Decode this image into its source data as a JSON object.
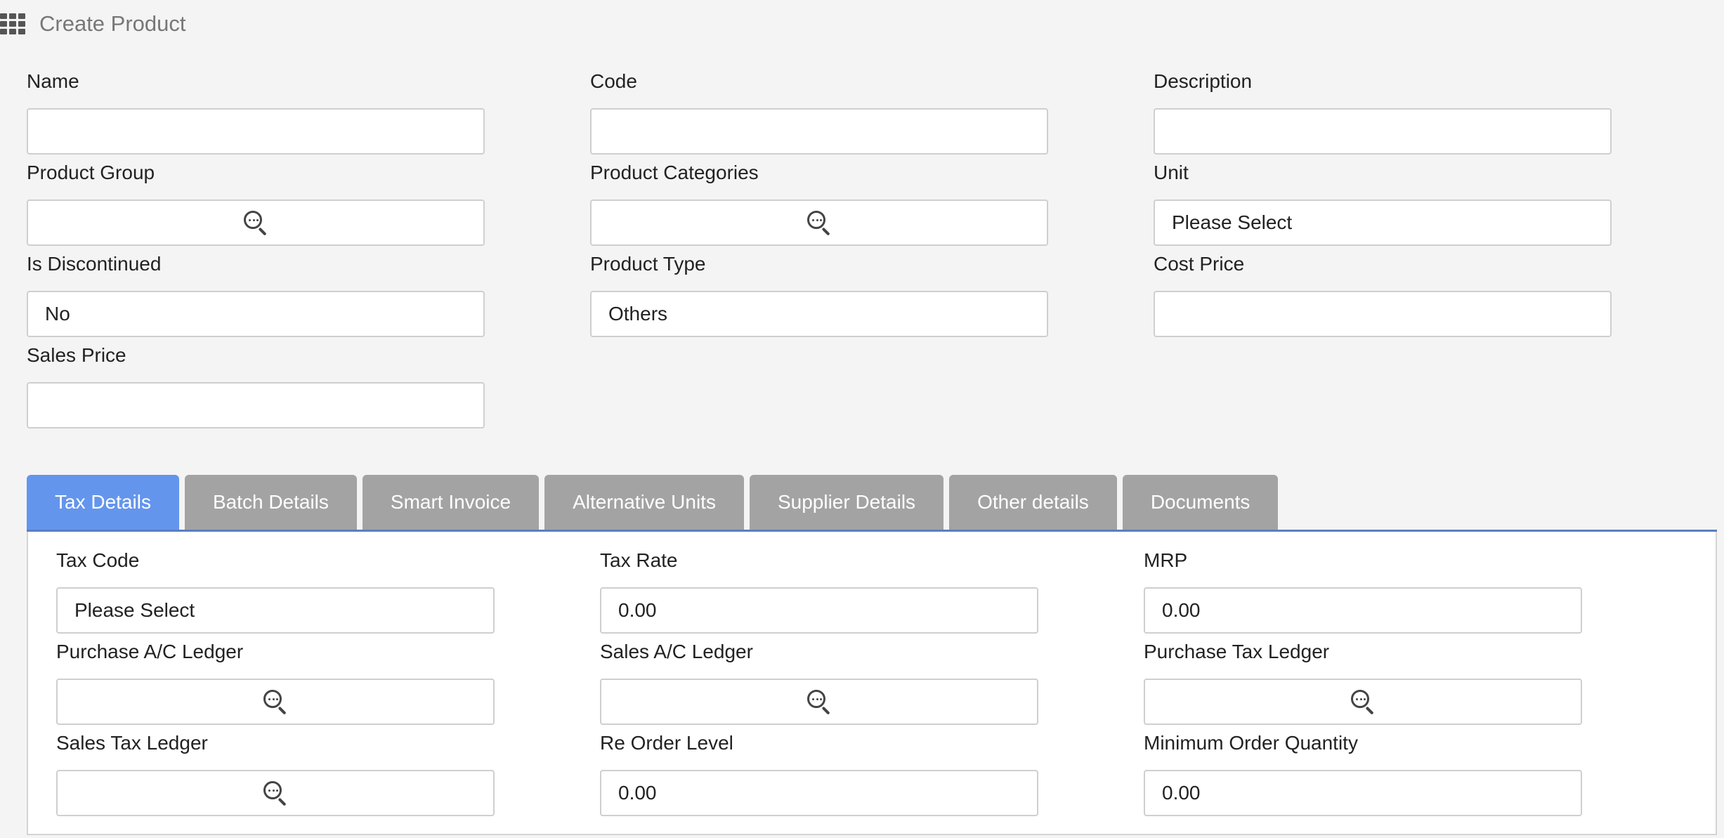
{
  "header": {
    "title": "Create Product",
    "icon": "apps-grid-icon"
  },
  "form": {
    "name": {
      "label": "Name",
      "value": ""
    },
    "code": {
      "label": "Code",
      "value": ""
    },
    "description": {
      "label": "Description",
      "value": ""
    },
    "product_group": {
      "label": "Product Group",
      "value": ""
    },
    "product_categories": {
      "label": "Product Categories",
      "value": ""
    },
    "unit": {
      "label": "Unit",
      "value": "Please Select"
    },
    "is_discontinued": {
      "label": "Is Discontinued",
      "value": "No"
    },
    "product_type": {
      "label": "Product Type",
      "value": "Others"
    },
    "cost_price": {
      "label": "Cost Price",
      "value": ""
    },
    "sales_price": {
      "label": "Sales Price",
      "value": ""
    }
  },
  "tabs": [
    {
      "label": "Tax Details",
      "active": true
    },
    {
      "label": "Batch Details",
      "active": false
    },
    {
      "label": "Smart Invoice",
      "active": false
    },
    {
      "label": "Alternative Units",
      "active": false
    },
    {
      "label": "Supplier Details",
      "active": false
    },
    {
      "label": "Other details",
      "active": false
    },
    {
      "label": "Documents",
      "active": false
    }
  ],
  "tax_details": {
    "tax_code": {
      "label": "Tax Code",
      "value": "Please Select"
    },
    "tax_rate": {
      "label": "Tax Rate",
      "value": "0.00"
    },
    "mrp": {
      "label": "MRP",
      "value": "0.00"
    },
    "purchase_ac_ledger": {
      "label": "Purchase A/C Ledger",
      "value": ""
    },
    "sales_ac_ledger": {
      "label": "Sales A/C Ledger",
      "value": ""
    },
    "purchase_tax_ledger": {
      "label": "Purchase Tax Ledger",
      "value": ""
    },
    "sales_tax_ledger": {
      "label": "Sales Tax Ledger",
      "value": ""
    },
    "reorder_level": {
      "label": "Re Order Level",
      "value": "0.00"
    },
    "min_order_qty": {
      "label": "Minimum Order Quantity",
      "value": "0.00"
    }
  },
  "colors": {
    "active_tab": "#6495ed",
    "inactive_tab": "#a3a3a3",
    "background": "#f4f4f4"
  }
}
